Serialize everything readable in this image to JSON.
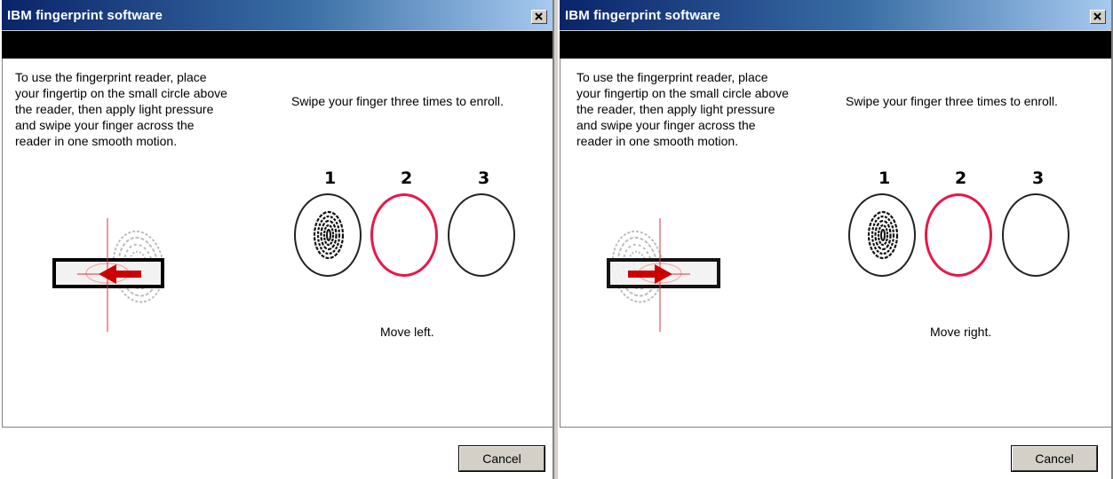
{
  "dialogs": [
    {
      "title": "IBM fingerprint software",
      "instructions": "To use the fingerprint reader, place your fingertip on the small circle above the reader, then apply light pressure and swipe your finger across the reader in one smooth motion.",
      "prompt": "Swipe your finger three times to enroll.",
      "step_labels": [
        "1",
        "2",
        "3"
      ],
      "status": "Move left.",
      "swipe_direction": "left",
      "cancel_label": "Cancel"
    },
    {
      "title": "IBM fingerprint software",
      "instructions": "To use the fingerprint reader, place your fingertip on the small circle above the reader, then apply light pressure and swipe your finger across the reader in one smooth motion.",
      "prompt": "Swipe your finger three times to enroll.",
      "step_labels": [
        "1",
        "2",
        "3"
      ],
      "status": "Move right.",
      "swipe_direction": "right",
      "cancel_label": "Cancel"
    }
  ],
  "colors": {
    "active_step": "#e8174a",
    "arrow": "#cc0000",
    "guide_line": "#e0303a",
    "titlebar": "#0a246a"
  },
  "icons": [
    "close-icon",
    "fingerprint-icon",
    "arrow-left-icon",
    "arrow-right-icon"
  ]
}
